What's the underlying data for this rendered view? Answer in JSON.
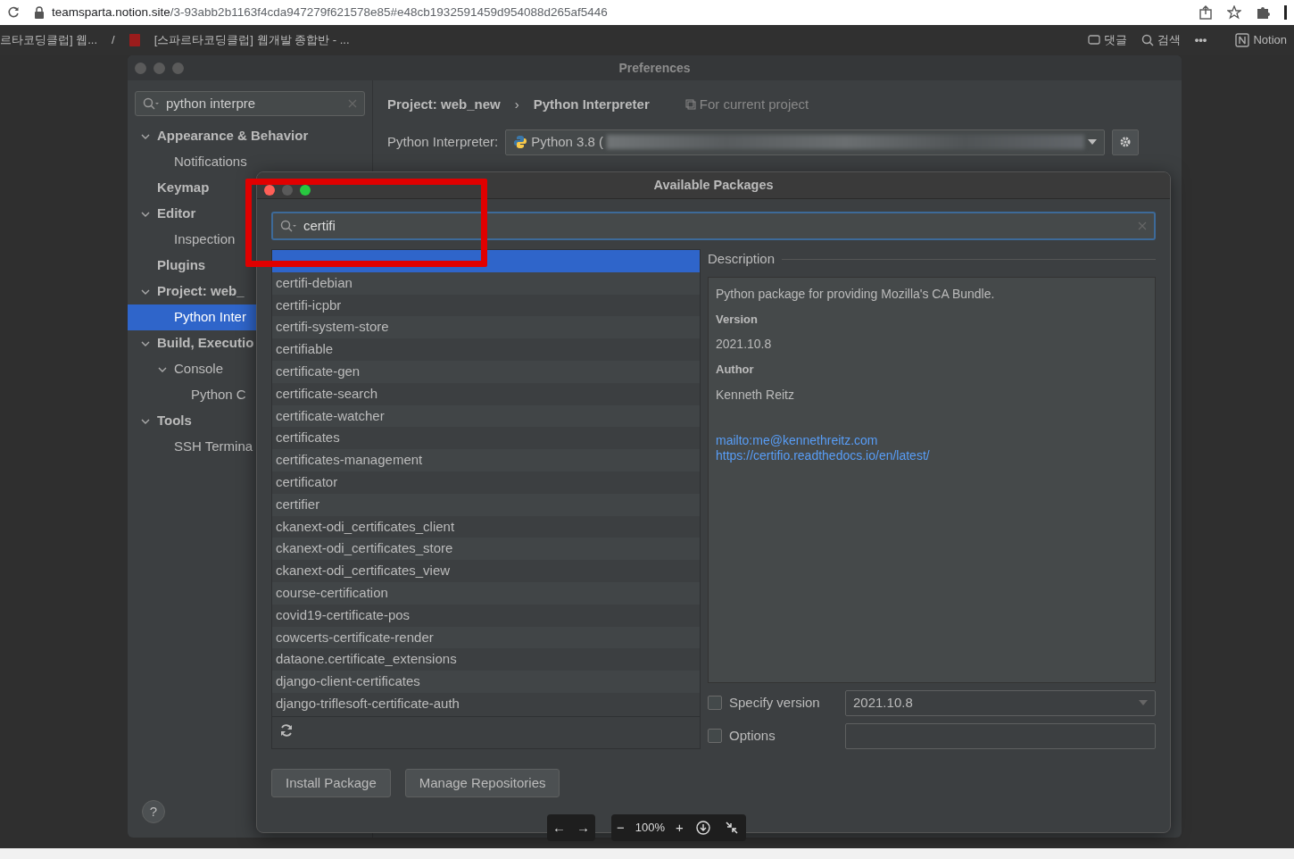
{
  "browser": {
    "url_host": "teamsparta.notion.site",
    "url_path": "/3-93abb2b1163f4cda947279f621578e85#e48cb1932591459d954088d265af5446"
  },
  "notion_bar": {
    "breadcrumbs": [
      "르타코딩클럽] 웹...",
      "[스파르타코딩클럽] 웹개발 종합반 - ..."
    ],
    "separator": "/",
    "comments": "댓글",
    "search": "검색",
    "more": "•••",
    "app": "Notion"
  },
  "preferences": {
    "title": "Preferences",
    "search": {
      "value": "python interpre"
    },
    "tree": [
      {
        "label": "Appearance & Behavior",
        "expanded": true,
        "selected": false,
        "children": [
          {
            "label": "Notifications",
            "selected": false
          }
        ]
      },
      {
        "label": "Keymap",
        "selected": false
      },
      {
        "label": "Editor",
        "expanded": true,
        "selected": false,
        "children": [
          {
            "label": "Inspection",
            "selected": false
          }
        ]
      },
      {
        "label": "Plugins",
        "selected": false
      },
      {
        "label": "Project: web_",
        "expanded": true,
        "selected": false,
        "children": [
          {
            "label": "Python Inter",
            "selected": true
          }
        ]
      },
      {
        "label": "Build, Executio",
        "expanded": true,
        "selected": false,
        "children": [
          {
            "label": "Console",
            "expanded": true,
            "selected": false,
            "children": [
              {
                "label": "Python C",
                "selected": false
              }
            ]
          }
        ]
      },
      {
        "label": "Tools",
        "expanded": true,
        "selected": false,
        "children": [
          {
            "label": "SSH Termina",
            "selected": false
          }
        ]
      }
    ],
    "breadcrumb": [
      "Project: web_new",
      "Python Interpreter"
    ],
    "breadcrumb_separator": "›",
    "scope": "For current project",
    "interpreter_label": "Python Interpreter:",
    "interpreter_value": "Python 3.8 (",
    "help": "?"
  },
  "dialog": {
    "title": "Available Packages",
    "search": {
      "value": "certifi"
    },
    "packages": [
      {
        "selected": true
      },
      {
        "name": "certifi-debian",
        "selected": false
      },
      {
        "name": "certifi-icpbr",
        "selected": false
      },
      {
        "name": "certifi-system-store",
        "selected": false
      },
      {
        "name": "certifiable",
        "selected": false
      },
      {
        "name": "certificate-gen",
        "selected": false
      },
      {
        "name": "certificate-search",
        "selected": false
      },
      {
        "name": "certificate-watcher",
        "selected": false
      },
      {
        "name": "certificates",
        "selected": false
      },
      {
        "name": "certificates-management",
        "selected": false
      },
      {
        "name": "certificator",
        "selected": false
      },
      {
        "name": "certifier",
        "selected": false
      },
      {
        "name": "ckanext-odi_certificates_client",
        "selected": false
      },
      {
        "name": "ckanext-odi_certificates_store",
        "selected": false
      },
      {
        "name": "ckanext-odi_certificates_view",
        "selected": false
      },
      {
        "name": "course-certification",
        "selected": false
      },
      {
        "name": "covid19-certificate-pos",
        "selected": false
      },
      {
        "name": "cowcerts-certificate-render",
        "selected": false
      },
      {
        "name": "dataone.certificate_extensions",
        "selected": false
      },
      {
        "name": "django-client-certificates",
        "selected": false
      },
      {
        "name": "django-triflesoft-certificate-auth",
        "selected": false
      }
    ],
    "description": {
      "heading": "Description",
      "summary": "Python package for providing Mozilla's CA Bundle.",
      "fields": [
        {
          "label": "Version",
          "value": "2021.10.8"
        },
        {
          "label": "Author",
          "value": "Kenneth Reitz"
        }
      ],
      "links": [
        "mailto:me@kennethreitz.com",
        "https://certifio.readthedocs.io/en/latest/"
      ]
    },
    "options": [
      {
        "kind": "dropdown",
        "label": "Specify version",
        "checked": false,
        "value": "2021.10.8"
      },
      {
        "kind": "text",
        "label": "Options",
        "checked": false
      }
    ],
    "buttons": [
      "Install Package",
      "Manage Repositories"
    ]
  },
  "viewer_toolbar": {
    "back": "←",
    "forward": "→",
    "zoom_out": "−",
    "zoom": "100%",
    "zoom_in": "+"
  }
}
